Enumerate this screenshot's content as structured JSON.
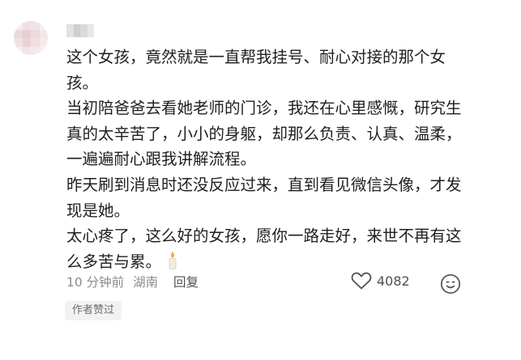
{
  "comment": {
    "lines": [
      "这个女孩，竟然就是一直帮我挂号、耐心对接的那个女孩。",
      "当初陪爸爸去看她老师的门诊，我还在心里感慨，研究生真的太辛苦了，小小的身躯，却那么负责、认真、温柔，一遍遍耐心跟我讲解流程。",
      "昨天刷到消息时还没反应过来，直到看见微信头像，才发现是她。",
      "太心疼了，这么好的女孩，愿你一路走好，来世不再有这么多苦与累。"
    ],
    "trailing_emoji": "candle-icon"
  },
  "meta": {
    "time": "10 分钟前",
    "location": "湖南",
    "reply_label": "回复"
  },
  "like": {
    "count": "4082",
    "icon": "heart-outline-icon"
  },
  "emoji_button": {
    "icon": "smiley-icon"
  },
  "author_badge": {
    "label": "作者赞过"
  },
  "colors": {
    "text": "#1f1f1f",
    "meta": "#8a8a8a",
    "badge_bg": "#f2f2f2"
  }
}
